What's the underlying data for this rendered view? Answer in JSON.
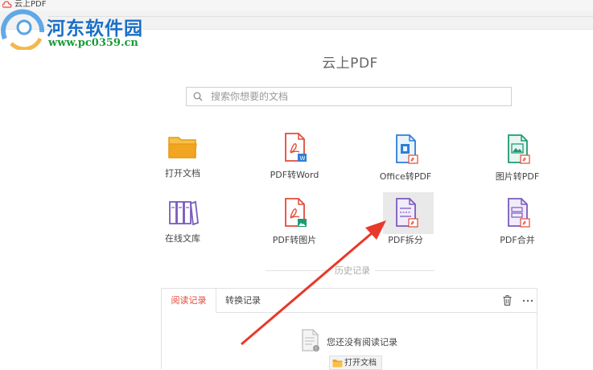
{
  "window": {
    "title": "云上PDF"
  },
  "watermark": {
    "site_name": "河东软件园",
    "url": "www.pc0359.cn"
  },
  "app": {
    "title": "云上PDF"
  },
  "search": {
    "placeholder": "搜索你想要的文档"
  },
  "tools": [
    {
      "id": "open-doc",
      "label": "打开文档",
      "icon": "folder-icon",
      "color": "#f2a521"
    },
    {
      "id": "pdf-to-word",
      "label": "PDF转Word",
      "icon": "pdf-to-word-icon",
      "color": "#e24b3b"
    },
    {
      "id": "office-to-pdf",
      "label": "Office转PDF",
      "icon": "office-to-pdf-icon",
      "color": "#2f7fd6"
    },
    {
      "id": "image-to-pdf",
      "label": "图片转PDF",
      "icon": "image-to-pdf-icon",
      "color": "#1f9a74"
    },
    {
      "id": "online-library",
      "label": "在线文库",
      "icon": "library-icon",
      "color": "#7a5bc0"
    },
    {
      "id": "pdf-to-image",
      "label": "PDF转图片",
      "icon": "pdf-to-image-icon",
      "color": "#e24b3b"
    },
    {
      "id": "pdf-split",
      "label": "PDF拆分",
      "icon": "pdf-split-icon",
      "color": "#7a5bc0"
    },
    {
      "id": "pdf-merge",
      "label": "PDF合并",
      "icon": "pdf-merge-icon",
      "color": "#7a5bc0"
    }
  ],
  "history": {
    "section_label": "历史记录",
    "tabs": [
      {
        "label": "阅读记录",
        "active": true
      },
      {
        "label": "转换记录",
        "active": false
      }
    ],
    "empty_text": "您还没有阅读记录",
    "open_button_label": "打开文档"
  },
  "colors": {
    "accent": "#e24b3b",
    "arrow": "#e8392a"
  }
}
